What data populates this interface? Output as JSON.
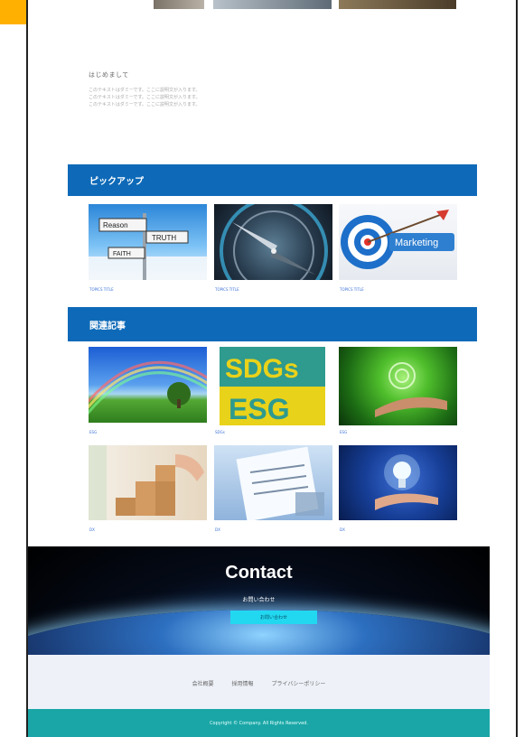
{
  "intro": {
    "title": "はじめまして",
    "lines": [
      "このテキストはダミーです。ここに説明文が入ります。",
      "このテキストはダミーです。ここに説明文が入ります。",
      "このテキストはダミーです。ここに説明文が入ります。"
    ]
  },
  "sections": {
    "pickup": {
      "title": "ピックアップ",
      "captions": [
        "TOPICS TITLE",
        "TOPICS TITLE",
        "TOPICS TITLE"
      ]
    },
    "related": {
      "title": "関連記事",
      "captions": [
        "ESG",
        "SDGs",
        "ESG",
        "DX",
        "DX",
        "DX"
      ]
    }
  },
  "images": {
    "signpost_labels": [
      "Reason",
      "TRUTH",
      "FAITH"
    ],
    "marketing_label": "Marketing",
    "sdgs_text": "SDGs",
    "esg_text": "ESG"
  },
  "contact": {
    "title": "Contact",
    "subtitle": "お問い合わせ",
    "button_label": "お問い合わせ"
  },
  "footer": {
    "links": [
      "会社概要",
      "採用情報",
      "プライバシーポリシー"
    ],
    "copyright": "Copyright © Company. All Rights Reserved."
  },
  "colors": {
    "accent": "#ffb000",
    "band": "#0e6ab8",
    "footer_bar": "#1aa6a6",
    "button": "#22d8f0"
  }
}
